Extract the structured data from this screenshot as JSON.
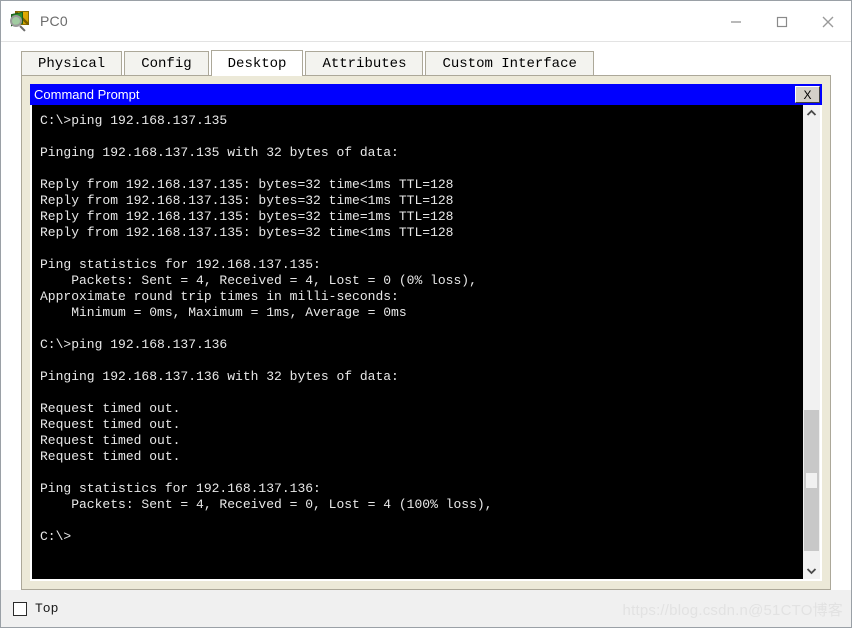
{
  "window": {
    "title": "PC0",
    "icon": "packet-tracer-device-icon",
    "controls": {
      "minimize": "minimize-icon",
      "maximize": "maximize-icon",
      "close": "close-icon"
    }
  },
  "tabs": [
    {
      "label": "Physical",
      "active": false
    },
    {
      "label": "Config",
      "active": false
    },
    {
      "label": "Desktop",
      "active": true
    },
    {
      "label": "Attributes",
      "active": false
    },
    {
      "label": "Custom Interface",
      "active": false
    }
  ],
  "cmd": {
    "title": "Command Prompt",
    "close_label": "X",
    "colors": {
      "titlebar": "#0000FF",
      "title_text": "#FFFFFF",
      "console_bg": "#000000",
      "console_text": "#E8E8E8",
      "panel_bg": "#ECE9D8"
    },
    "lines": [
      "C:\\>ping 192.168.137.135",
      "",
      "Pinging 192.168.137.135 with 32 bytes of data:",
      "",
      "Reply from 192.168.137.135: bytes=32 time<1ms TTL=128",
      "Reply from 192.168.137.135: bytes=32 time<1ms TTL=128",
      "Reply from 192.168.137.135: bytes=32 time=1ms TTL=128",
      "Reply from 192.168.137.135: bytes=32 time<1ms TTL=128",
      "",
      "Ping statistics for 192.168.137.135:",
      "    Packets: Sent = 4, Received = 4, Lost = 0 (0% loss),",
      "Approximate round trip times in milli-seconds:",
      "    Minimum = 0ms, Maximum = 1ms, Average = 0ms",
      "",
      "C:\\>ping 192.168.137.136",
      "",
      "Pinging 192.168.137.136 with 32 bytes of data:",
      "",
      "Request timed out.",
      "Request timed out.",
      "Request timed out.",
      "Request timed out.",
      "",
      "Ping statistics for 192.168.137.136:",
      "    Packets: Sent = 4, Received = 0, Lost = 4 (100% loss),",
      "",
      "C:\\>"
    ]
  },
  "scrollbar": {
    "up_arrow": "chevron-up-icon",
    "down_arrow": "chevron-down-icon",
    "thumb_top_percent": 65.5,
    "thumb_height_percent": 32
  },
  "bottom": {
    "top_checkbox_label": "Top",
    "top_checkbox_checked": false,
    "watermark": "https://blog.csdn.n@51CTO博客"
  }
}
